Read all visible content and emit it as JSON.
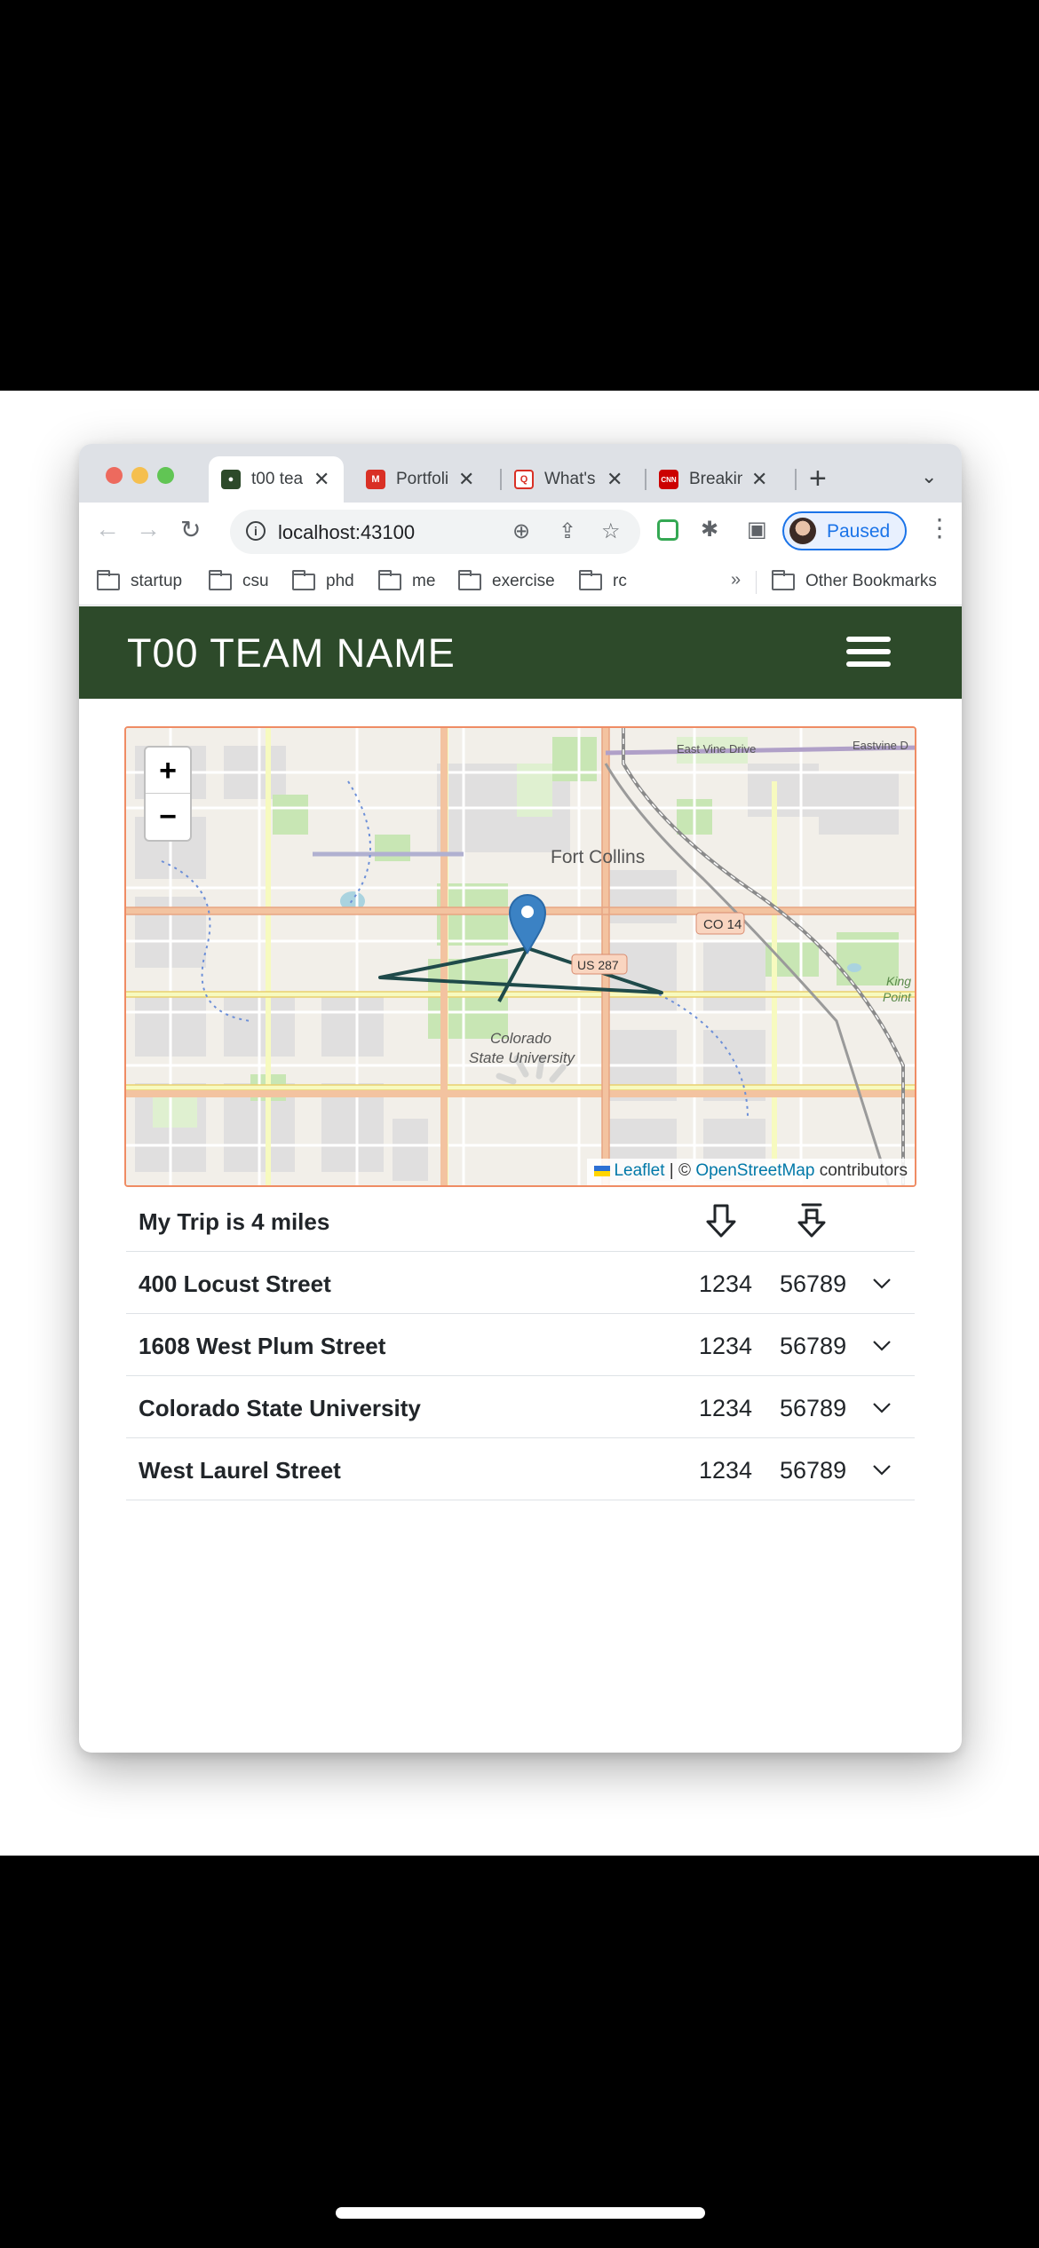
{
  "browser": {
    "tabs": [
      {
        "label": "t00 tea",
        "favicon_color": "#2d4a2a",
        "active": true
      },
      {
        "label": "Portfoli",
        "favicon_color": "#d93025",
        "active": false
      },
      {
        "label": "What's",
        "favicon_color": "#d93025",
        "active": false
      },
      {
        "label": "Breakin",
        "favicon_color": "#cc0000",
        "active": false
      }
    ],
    "favicon_glyphs": [
      "",
      "M",
      "Q",
      "CNN"
    ],
    "new_tab": "+",
    "tab_menu": "⌄",
    "close": "✕",
    "back": "←",
    "forward": "→",
    "reload": "↻",
    "url": "localhost:43100",
    "info_icon": "i",
    "zoom_icon": "⊕",
    "share_icon": "⇪",
    "star_icon": "☆",
    "puzzle_icon": "✱",
    "sidepanel_icon": "▣",
    "profile_label": "Paused",
    "menu_icon": "⋮",
    "bookmarks": [
      "startup",
      "csu",
      "phd",
      "me",
      "exercise",
      "rc"
    ],
    "bookmarks_more": "»",
    "other_bookmarks": "Other Bookmarks"
  },
  "app": {
    "title": "T00 TEAM NAME",
    "colors": {
      "header": "#2d4a2a",
      "route": "#1f4a4a",
      "marker": "#3b82c4",
      "map_border": "#ef8c64"
    }
  },
  "map": {
    "zoom_in": "+",
    "zoom_out": "−",
    "labels": {
      "city": "Fort Collins",
      "campus_1": "Colorado",
      "campus_2": "State University",
      "us287": "US 287",
      "co14": "CO 14",
      "east_vine": "East Vine Drive",
      "eastvine_short": "Eastvine D",
      "kingfisher_1": "King",
      "kingfisher_2": "Point"
    },
    "attribution": {
      "leaflet": "Leaflet",
      "sep": " | © ",
      "osm": "OpenStreetMap",
      "contributors": " contributors"
    }
  },
  "trip": {
    "title": "My Trip is 4 miles",
    "places": [
      {
        "name": "400 Locust Street",
        "value_1": "1234",
        "value_2": "56789"
      },
      {
        "name": "1608 West Plum Street",
        "value_1": "1234",
        "value_2": "56789"
      },
      {
        "name": "Colorado State University",
        "value_1": "1234",
        "value_2": "56789"
      },
      {
        "name": "West Laurel Street",
        "value_1": "1234",
        "value_2": "56789"
      }
    ]
  }
}
